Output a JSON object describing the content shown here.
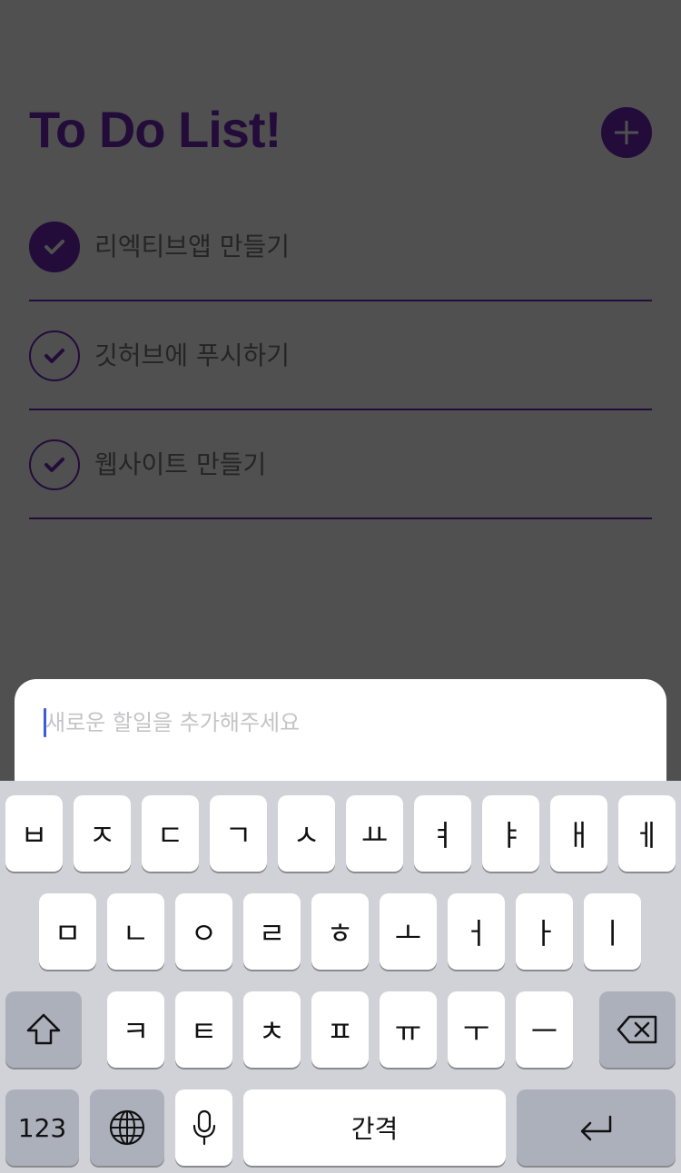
{
  "app": {
    "title": "To Do List!",
    "add_button_icon": "plus-icon",
    "colors": {
      "primary": "#230c3a",
      "text": "#252525",
      "overlay": "#505050",
      "caret": "#3d5bd9"
    }
  },
  "todos": [
    {
      "text": "리엑티브앱 만들기",
      "completed": true
    },
    {
      "text": "깃허브에 푸시하기",
      "completed": false
    },
    {
      "text": "웹사이트 만들기",
      "completed": false
    }
  ],
  "input": {
    "placeholder": "새로운 할일을 추가해주세요",
    "value": ""
  },
  "keyboard": {
    "row1": [
      "ㅂ",
      "ㅈ",
      "ㄷ",
      "ㄱ",
      "ㅅ",
      "ㅛ",
      "ㅕ",
      "ㅑ",
      "ㅐ",
      "ㅔ"
    ],
    "row2": [
      "ㅁ",
      "ㄴ",
      "ㅇ",
      "ㄹ",
      "ㅎ",
      "ㅗ",
      "ㅓ",
      "ㅏ",
      "ㅣ"
    ],
    "row3": [
      "ㅋ",
      "ㅌ",
      "ㅊ",
      "ㅍ",
      "ㅠ",
      "ㅜ",
      "ㅡ"
    ],
    "numbers_label": "123",
    "space_label": "간격",
    "icons": {
      "shift": "shift-icon",
      "delete": "backspace-icon",
      "globe": "globe-icon",
      "mic": "microphone-icon",
      "return": "return-icon"
    }
  }
}
